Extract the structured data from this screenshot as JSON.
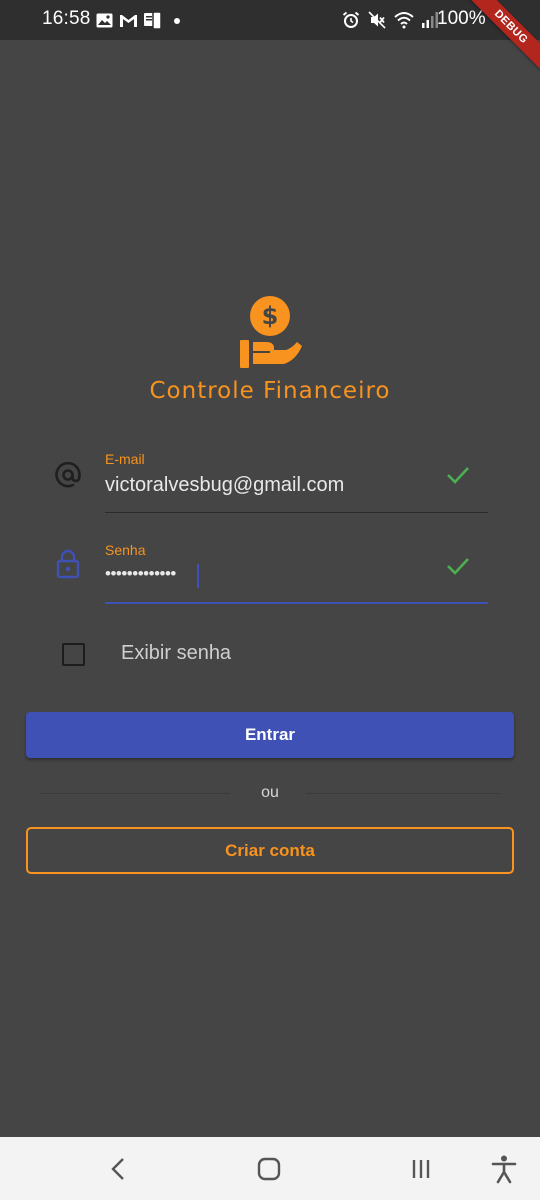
{
  "status_bar": {
    "time": "16:58",
    "battery_percent": "100%",
    "left_icons": [
      "gallery-icon",
      "gmail-icon",
      "mobile-app-icon",
      "dot-icon"
    ],
    "right_icons": [
      "alarm-icon",
      "mute-icon",
      "wifi-icon",
      "signal-icon",
      "battery-icon"
    ]
  },
  "debug_banner": "DEBUG",
  "app": {
    "title": "Controle Financeiro",
    "logo_icon": "money-hand-icon",
    "accent_color": "#f7931e",
    "primary_color": "#3f51b5",
    "background_color": "#454545"
  },
  "form": {
    "email": {
      "label": "E-mail",
      "value": "victoralvesbug@gmail.com",
      "icon": "at-icon",
      "valid": true
    },
    "password": {
      "label": "Senha",
      "value": "•••••••••••••",
      "icon": "lock-icon",
      "valid": true
    },
    "show_password": {
      "label": "Exibir senha",
      "checked": false
    }
  },
  "buttons": {
    "login_label": "Entrar",
    "divider_text": "ou",
    "create_account_label": "Criar conta"
  },
  "nav_bar": {
    "icons": [
      "back-icon",
      "home-icon",
      "recents-icon",
      "accessibility-icon"
    ]
  }
}
